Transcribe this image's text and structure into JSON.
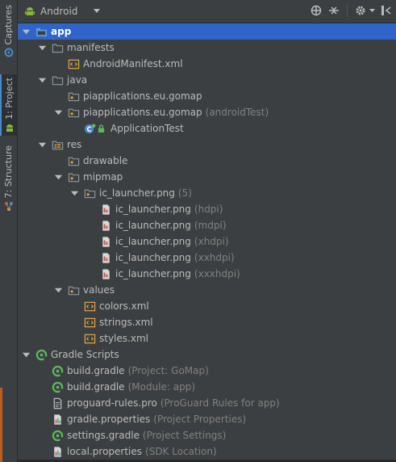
{
  "sidebar": {
    "tabs": [
      {
        "label": "Captures"
      },
      {
        "label": "1: Project"
      },
      {
        "label": "7: Structure"
      }
    ]
  },
  "toolbar": {
    "view_mode": "Android"
  },
  "tree": [
    {
      "label": "app",
      "hint": "",
      "depth": 0,
      "arrow": "down",
      "icon": "module-folder-icon",
      "selected": true
    },
    {
      "label": "manifests",
      "hint": "",
      "depth": 1,
      "arrow": "down",
      "icon": "folder-icon"
    },
    {
      "label": "AndroidManifest.xml",
      "hint": "",
      "depth": 2,
      "arrow": "none",
      "icon": "xml-file-icon"
    },
    {
      "label": "java",
      "hint": "",
      "depth": 1,
      "arrow": "down",
      "icon": "folder-icon"
    },
    {
      "label": "piapplications.eu.gomap",
      "hint": "",
      "depth": 2,
      "arrow": "none",
      "icon": "package-icon"
    },
    {
      "label": "piapplications.eu.gomap",
      "hint": "(androidTest)",
      "depth": 2,
      "arrow": "down",
      "icon": "package-icon"
    },
    {
      "label": "ApplicationTest",
      "hint": "",
      "depth": 3,
      "arrow": "none",
      "icon": "class-icon"
    },
    {
      "label": "res",
      "hint": "",
      "depth": 1,
      "arrow": "down",
      "icon": "res-folder-icon"
    },
    {
      "label": "drawable",
      "hint": "",
      "depth": 2,
      "arrow": "none",
      "icon": "package-icon"
    },
    {
      "label": "mipmap",
      "hint": "",
      "depth": 2,
      "arrow": "down",
      "icon": "package-icon"
    },
    {
      "label": "ic_launcher.png",
      "hint": "(5)",
      "depth": 3,
      "arrow": "down",
      "icon": "package-icon"
    },
    {
      "label": "ic_launcher.png",
      "hint": "(hdpi)",
      "depth": 4,
      "arrow": "none",
      "icon": "image-file-icon"
    },
    {
      "label": "ic_launcher.png",
      "hint": "(mdpi)",
      "depth": 4,
      "arrow": "none",
      "icon": "image-file-icon"
    },
    {
      "label": "ic_launcher.png",
      "hint": "(xhdpi)",
      "depth": 4,
      "arrow": "none",
      "icon": "image-file-icon"
    },
    {
      "label": "ic_launcher.png",
      "hint": "(xxhdpi)",
      "depth": 4,
      "arrow": "none",
      "icon": "image-file-icon"
    },
    {
      "label": "ic_launcher.png",
      "hint": "(xxxhdpi)",
      "depth": 4,
      "arrow": "none",
      "icon": "image-file-icon"
    },
    {
      "label": "values",
      "hint": "",
      "depth": 2,
      "arrow": "down",
      "icon": "package-icon"
    },
    {
      "label": "colors.xml",
      "hint": "",
      "depth": 3,
      "arrow": "none",
      "icon": "xml-file-icon"
    },
    {
      "label": "strings.xml",
      "hint": "",
      "depth": 3,
      "arrow": "none",
      "icon": "xml-file-icon"
    },
    {
      "label": "styles.xml",
      "hint": "",
      "depth": 3,
      "arrow": "none",
      "icon": "xml-file-icon"
    },
    {
      "label": "Gradle Scripts",
      "hint": "",
      "depth": 0,
      "arrow": "down",
      "icon": "gradle-icon"
    },
    {
      "label": "build.gradle",
      "hint": "(Project: GoMap)",
      "depth": 1,
      "arrow": "none",
      "icon": "gradle-icon"
    },
    {
      "label": "build.gradle",
      "hint": "(Module: app)",
      "depth": 1,
      "arrow": "none",
      "icon": "gradle-icon"
    },
    {
      "label": "proguard-rules.pro",
      "hint": "(ProGuard Rules for app)",
      "depth": 1,
      "arrow": "none",
      "icon": "text-file-icon"
    },
    {
      "label": "gradle.properties",
      "hint": "(Project Properties)",
      "depth": 1,
      "arrow": "none",
      "icon": "properties-file-icon"
    },
    {
      "label": "settings.gradle",
      "hint": "(Project Settings)",
      "depth": 1,
      "arrow": "none",
      "icon": "gradle-icon"
    },
    {
      "label": "local.properties",
      "hint": "(SDK Location)",
      "depth": 1,
      "arrow": "none",
      "icon": "properties-file-icon"
    }
  ],
  "colors": {
    "background": "#3c3f41",
    "selection": "#2f65ca",
    "text": "#bbbbbb",
    "hint": "#808080",
    "folder": "#87939a",
    "xml": "#e8a33d",
    "gradle": "#5bb85b"
  }
}
